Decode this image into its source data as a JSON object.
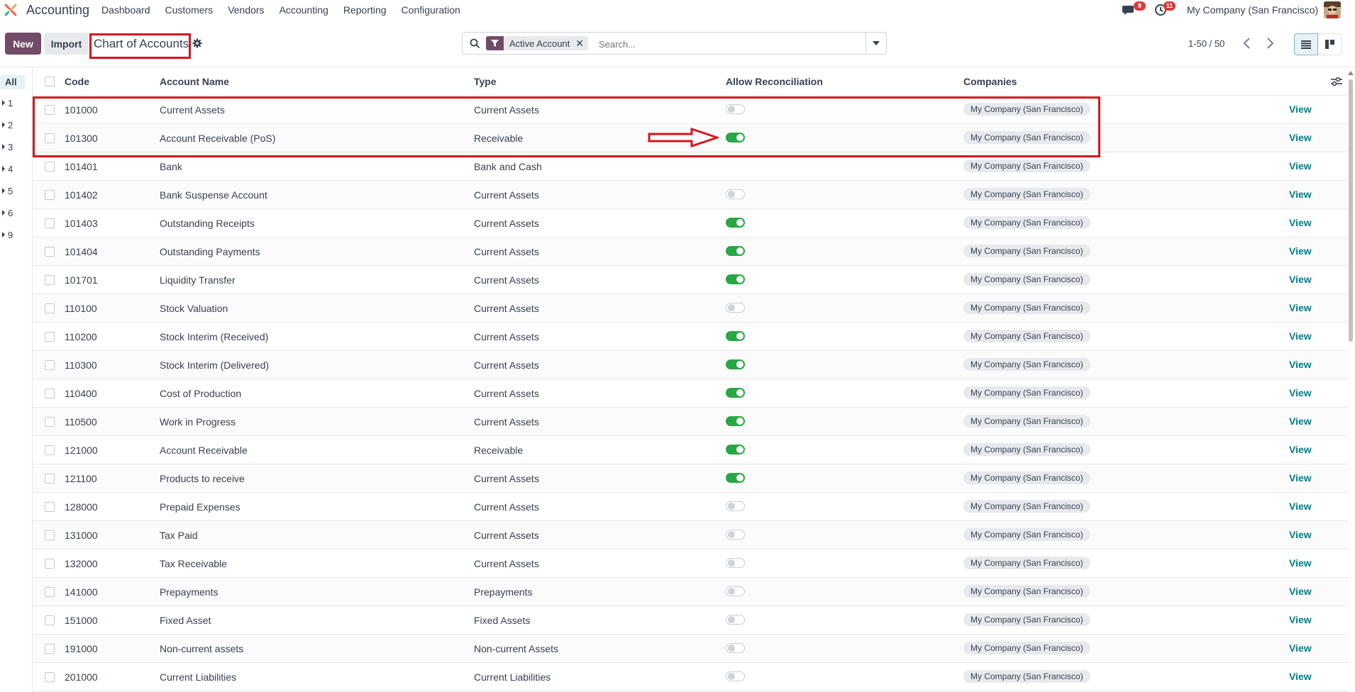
{
  "app": {
    "title": "Accounting"
  },
  "menu": [
    {
      "label": "Dashboard"
    },
    {
      "label": "Customers"
    },
    {
      "label": "Vendors"
    },
    {
      "label": "Accounting"
    },
    {
      "label": "Reporting"
    },
    {
      "label": "Configuration"
    }
  ],
  "systray": {
    "messages_count": "8",
    "activities_count": "11",
    "company": "My Company (San Francisco)"
  },
  "toolbar": {
    "new_label": "New",
    "import_label": "Import",
    "page_title": "Chart of Accounts"
  },
  "search": {
    "facet": "Active Account",
    "facet_close": "✕",
    "placeholder": "Search..."
  },
  "pager": {
    "value": "1-50 / 50"
  },
  "left_panel": {
    "all_label": "All",
    "groups": [
      "1",
      "2",
      "3",
      "4",
      "5",
      "6",
      "9"
    ]
  },
  "columns": {
    "code": "Code",
    "name": "Account Name",
    "type": "Type",
    "reconcile": "Allow Reconciliation",
    "companies": "Companies"
  },
  "view_label": "View",
  "colors": {
    "brand": "#714b67",
    "toggle_on": "#28a745",
    "link": "#017e84",
    "annotation": "#d9141e"
  },
  "rows": [
    {
      "code": "101000",
      "name": "Current Assets",
      "type": "Current Assets",
      "reconcile": "off",
      "company": "My Company (San Francisco)"
    },
    {
      "code": "101300",
      "name": "Account Receivable (PoS)",
      "type": "Receivable",
      "reconcile": "on",
      "company": "My Company (San Francisco)"
    },
    {
      "code": "101401",
      "name": "Bank",
      "type": "Bank and Cash",
      "reconcile": "none",
      "company": "My Company (San Francisco)"
    },
    {
      "code": "101402",
      "name": "Bank Suspense Account",
      "type": "Current Assets",
      "reconcile": "off",
      "company": "My Company (San Francisco)"
    },
    {
      "code": "101403",
      "name": "Outstanding Receipts",
      "type": "Current Assets",
      "reconcile": "on",
      "company": "My Company (San Francisco)"
    },
    {
      "code": "101404",
      "name": "Outstanding Payments",
      "type": "Current Assets",
      "reconcile": "on",
      "company": "My Company (San Francisco)"
    },
    {
      "code": "101701",
      "name": "Liquidity Transfer",
      "type": "Current Assets",
      "reconcile": "on",
      "company": "My Company (San Francisco)"
    },
    {
      "code": "110100",
      "name": "Stock Valuation",
      "type": "Current Assets",
      "reconcile": "off",
      "company": "My Company (San Francisco)"
    },
    {
      "code": "110200",
      "name": "Stock Interim (Received)",
      "type": "Current Assets",
      "reconcile": "on",
      "company": "My Company (San Francisco)"
    },
    {
      "code": "110300",
      "name": "Stock Interim (Delivered)",
      "type": "Current Assets",
      "reconcile": "on",
      "company": "My Company (San Francisco)"
    },
    {
      "code": "110400",
      "name": "Cost of Production",
      "type": "Current Assets",
      "reconcile": "on",
      "company": "My Company (San Francisco)"
    },
    {
      "code": "110500",
      "name": "Work in Progress",
      "type": "Current Assets",
      "reconcile": "on",
      "company": "My Company (San Francisco)"
    },
    {
      "code": "121000",
      "name": "Account Receivable",
      "type": "Receivable",
      "reconcile": "on",
      "company": "My Company (San Francisco)"
    },
    {
      "code": "121100",
      "name": "Products to receive",
      "type": "Current Assets",
      "reconcile": "on",
      "company": "My Company (San Francisco)"
    },
    {
      "code": "128000",
      "name": "Prepaid Expenses",
      "type": "Current Assets",
      "reconcile": "off",
      "company": "My Company (San Francisco)"
    },
    {
      "code": "131000",
      "name": "Tax Paid",
      "type": "Current Assets",
      "reconcile": "off",
      "company": "My Company (San Francisco)"
    },
    {
      "code": "132000",
      "name": "Tax Receivable",
      "type": "Current Assets",
      "reconcile": "off",
      "company": "My Company (San Francisco)"
    },
    {
      "code": "141000",
      "name": "Prepayments",
      "type": "Prepayments",
      "reconcile": "off",
      "company": "My Company (San Francisco)"
    },
    {
      "code": "151000",
      "name": "Fixed Asset",
      "type": "Fixed Assets",
      "reconcile": "off",
      "company": "My Company (San Francisco)"
    },
    {
      "code": "191000",
      "name": "Non-current assets",
      "type": "Non-current Assets",
      "reconcile": "off",
      "company": "My Company (San Francisco)"
    },
    {
      "code": "201000",
      "name": "Current Liabilities",
      "type": "Current Liabilities",
      "reconcile": "off",
      "company": "My Company (San Francisco)"
    }
  ]
}
